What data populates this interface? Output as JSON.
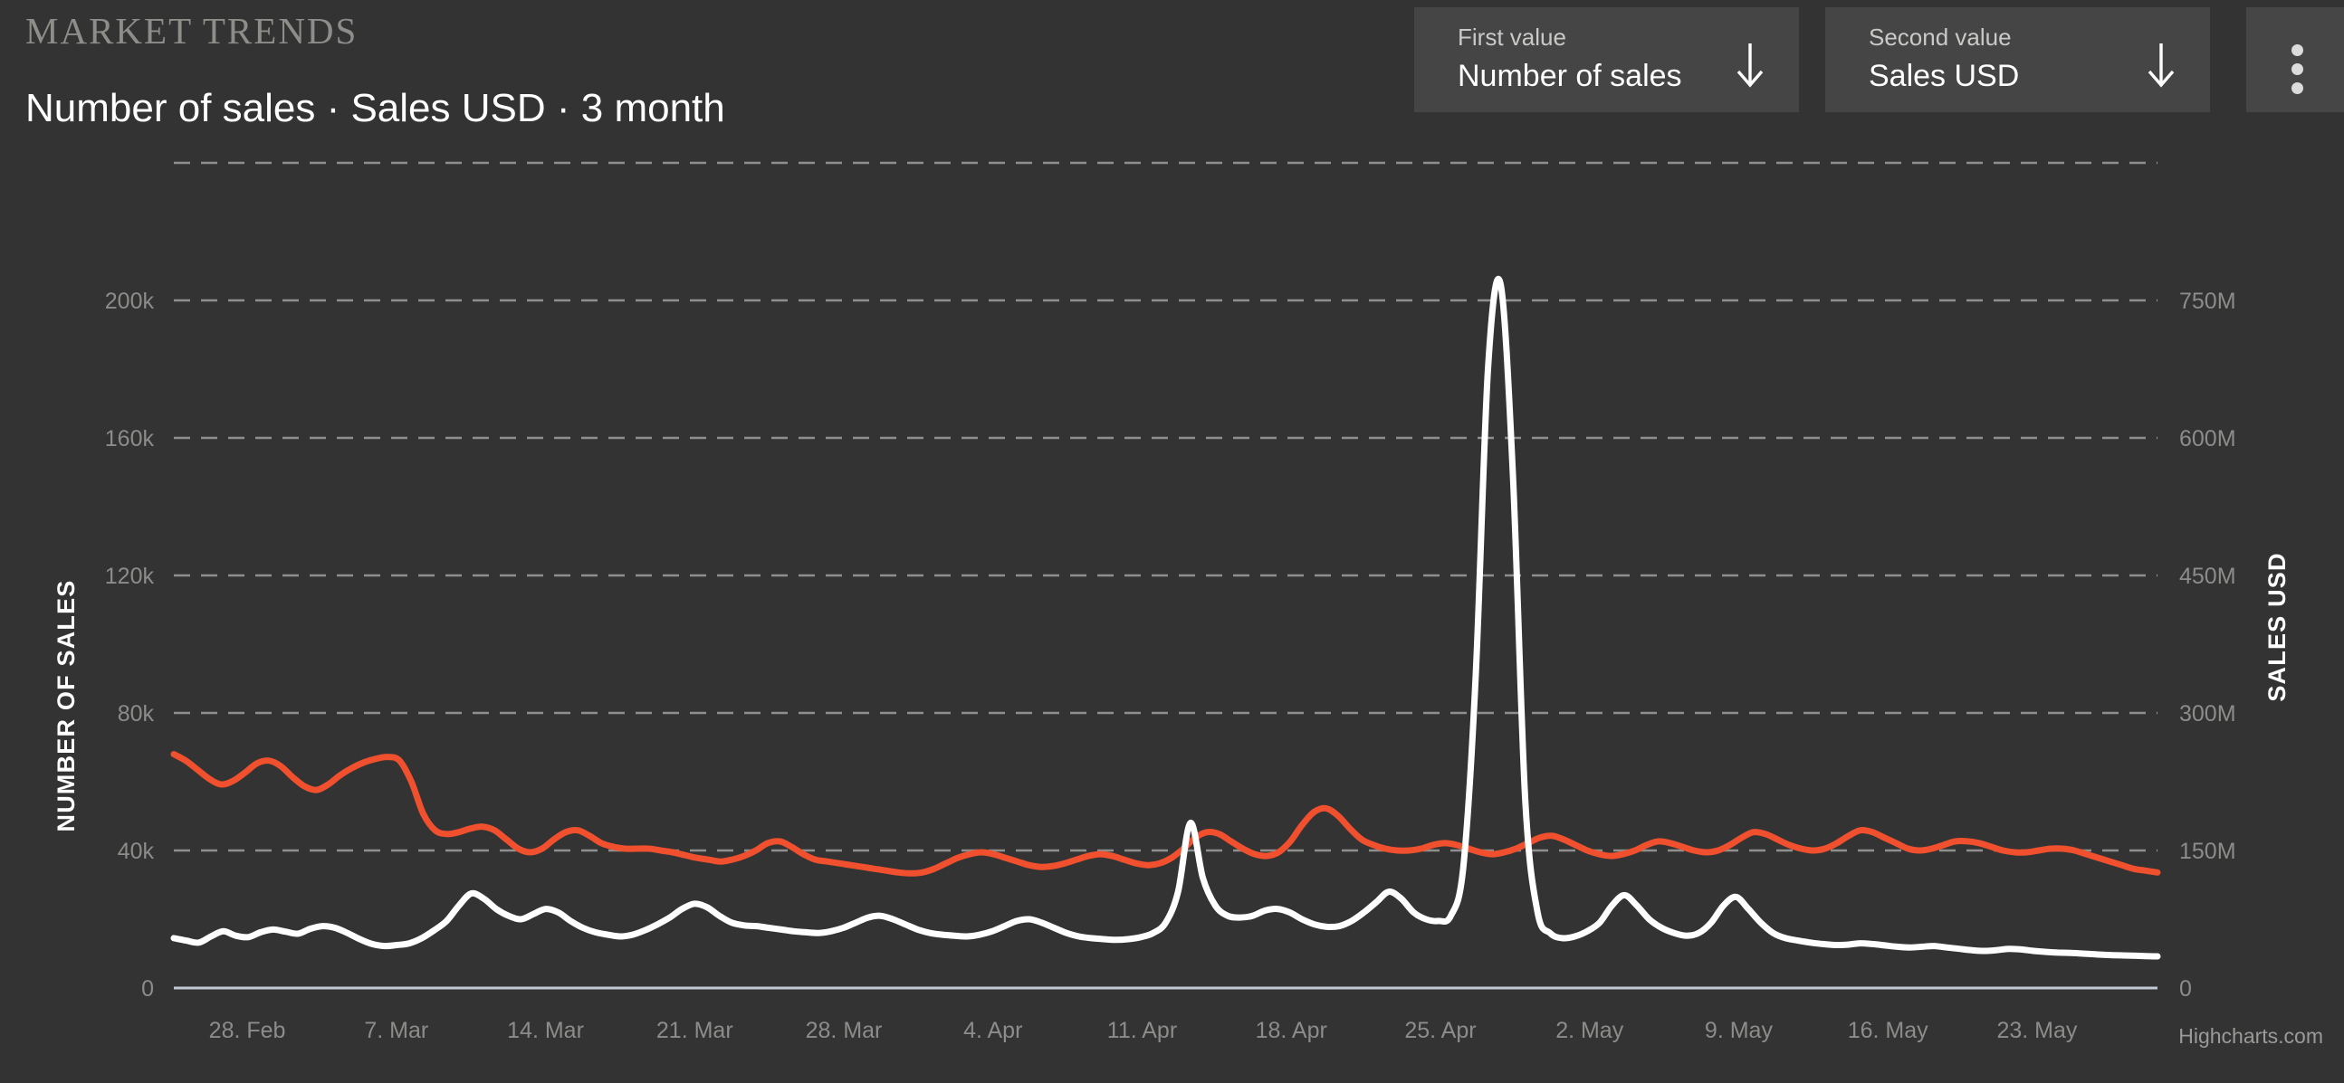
{
  "header": {
    "eyebrow": "MARKET TRENDS",
    "subtitle": "Number of sales · Sales USD · 3 month"
  },
  "controls": {
    "first": {
      "label": "First value",
      "value": "Number of sales",
      "icon": "arrow-down-icon"
    },
    "second": {
      "label": "Second value",
      "value": "Sales USD",
      "icon": "arrow-down-icon"
    },
    "menu": {
      "icon": "kebab-menu-icon"
    }
  },
  "credit": "Highcharts.com",
  "colors": {
    "background": "#333333",
    "panel": "#454545",
    "series_number_of_sales": "#ffffff",
    "series_sales_usd": "#f0502e",
    "gridline": "#8f8f8d",
    "axis_line": "#c3c9d4",
    "tick_text": "#8c8c8a"
  },
  "chart_data": {
    "type": "line",
    "title": "Number of sales · Sales USD · 3 month",
    "xlabel": "",
    "grid": true,
    "legend": "none",
    "x_tick_labels": [
      "28. Feb",
      "7. Mar",
      "14. Mar",
      "21. Mar",
      "28. Mar",
      "4. Apr",
      "11. Apr",
      "18. Apr",
      "25. Apr",
      "2. May",
      "9. May",
      "16. May",
      "23. May"
    ],
    "axes": {
      "left": {
        "label": "NUMBER OF SALES",
        "ticks": [
          0,
          40000,
          80000,
          120000,
          160000,
          200000
        ],
        "tick_labels": [
          "0",
          "40k",
          "80k",
          "120k",
          "160k",
          "200k"
        ],
        "ylim": [
          0,
          240000
        ]
      },
      "right": {
        "label": "SALES USD",
        "ticks": [
          0,
          150000000,
          300000000,
          450000000,
          600000000,
          750000000
        ],
        "tick_labels": [
          "0",
          "150M",
          "300M",
          "450M",
          "600M",
          "750M"
        ],
        "ylim": [
          0,
          900000000
        ]
      }
    },
    "series": [
      {
        "name": "Number of sales",
        "axis": "left",
        "color": "#ffffff",
        "values": [
          14500,
          13800,
          13200,
          15000,
          16500,
          15200,
          14800,
          16200,
          17000,
          16400,
          15800,
          17200,
          18000,
          17500,
          16000,
          14200,
          12800,
          12200,
          12500,
          13000,
          14500,
          16800,
          19500,
          24000,
          27500,
          26000,
          23000,
          21000,
          20000,
          21500,
          23000,
          22000,
          19500,
          17500,
          16200,
          15500,
          15000,
          15500,
          16800,
          18500,
          20500,
          23000,
          24500,
          23500,
          21000,
          19000,
          18200,
          18000,
          17500,
          17000,
          16500,
          16200,
          16000,
          16500,
          17500,
          19000,
          20500,
          21000,
          20000,
          18500,
          17000,
          16000,
          15500,
          15200,
          15000,
          15500,
          16500,
          18000,
          19500,
          20000,
          19000,
          17500,
          16000,
          15000,
          14500,
          14200,
          14000,
          14200,
          14800,
          16000,
          19000,
          28000,
          48000,
          32000,
          24000,
          21000,
          20500,
          21000,
          22500,
          23000,
          22000,
          20000,
          18500,
          17800,
          18000,
          19500,
          22000,
          25000,
          28000,
          26000,
          22000,
          20000,
          19500,
          21000,
          35000,
          90000,
          180000,
          205000,
          150000,
          55000,
          22000,
          16000,
          14500,
          15000,
          16500,
          19000,
          24000,
          27000,
          24000,
          20000,
          17500,
          16000,
          15200,
          16000,
          19000,
          24000,
          26500,
          23000,
          19000,
          16000,
          14500,
          13800,
          13200,
          12800,
          12500,
          12600,
          13000,
          12800,
          12400,
          12000,
          11800,
          12000,
          12200,
          11800,
          11400,
          11000,
          10800,
          11000,
          11400,
          11200,
          10800,
          10500,
          10300,
          10200,
          10000,
          9800,
          9600,
          9500,
          9400,
          9300,
          9200
        ]
      },
      {
        "name": "Sales USD",
        "axis": "right",
        "color": "#f0502e",
        "values": [
          255000000,
          248000000,
          238000000,
          228000000,
          222000000,
          226000000,
          235000000,
          245000000,
          248000000,
          242000000,
          230000000,
          220000000,
          216000000,
          222000000,
          232000000,
          240000000,
          246000000,
          250000000,
          252000000,
          248000000,
          225000000,
          190000000,
          172000000,
          168000000,
          170000000,
          174000000,
          176000000,
          172000000,
          162000000,
          152000000,
          148000000,
          152000000,
          162000000,
          170000000,
          172000000,
          166000000,
          158000000,
          154000000,
          152000000,
          152000000,
          152000000,
          150000000,
          148000000,
          145000000,
          142000000,
          140000000,
          138000000,
          140000000,
          144000000,
          150000000,
          158000000,
          160000000,
          154000000,
          146000000,
          140000000,
          138000000,
          136000000,
          134000000,
          132000000,
          130000000,
          128000000,
          126000000,
          125000000,
          126000000,
          130000000,
          136000000,
          142000000,
          146000000,
          148000000,
          146000000,
          142000000,
          138000000,
          134000000,
          132000000,
          133000000,
          136000000,
          140000000,
          144000000,
          146000000,
          144000000,
          140000000,
          136000000,
          134000000,
          136000000,
          142000000,
          152000000,
          164000000,
          170000000,
          168000000,
          160000000,
          152000000,
          146000000,
          144000000,
          148000000,
          160000000,
          178000000,
          192000000,
          196000000,
          188000000,
          174000000,
          162000000,
          156000000,
          152000000,
          150000000,
          150000000,
          152000000,
          156000000,
          158000000,
          156000000,
          152000000,
          148000000,
          146000000,
          148000000,
          152000000,
          158000000,
          164000000,
          166000000,
          162000000,
          156000000,
          150000000,
          146000000,
          144000000,
          146000000,
          150000000,
          156000000,
          160000000,
          158000000,
          154000000,
          150000000,
          148000000,
          150000000,
          156000000,
          164000000,
          170000000,
          168000000,
          162000000,
          156000000,
          152000000,
          150000000,
          152000000,
          158000000,
          166000000,
          172000000,
          170000000,
          164000000,
          158000000,
          152000000,
          150000000,
          152000000,
          156000000,
          160000000,
          160000000,
          158000000,
          154000000,
          150000000,
          148000000,
          148000000,
          150000000,
          152000000,
          152000000,
          150000000,
          146000000,
          142000000,
          138000000,
          134000000,
          130000000,
          128000000,
          126000000
        ]
      }
    ]
  }
}
